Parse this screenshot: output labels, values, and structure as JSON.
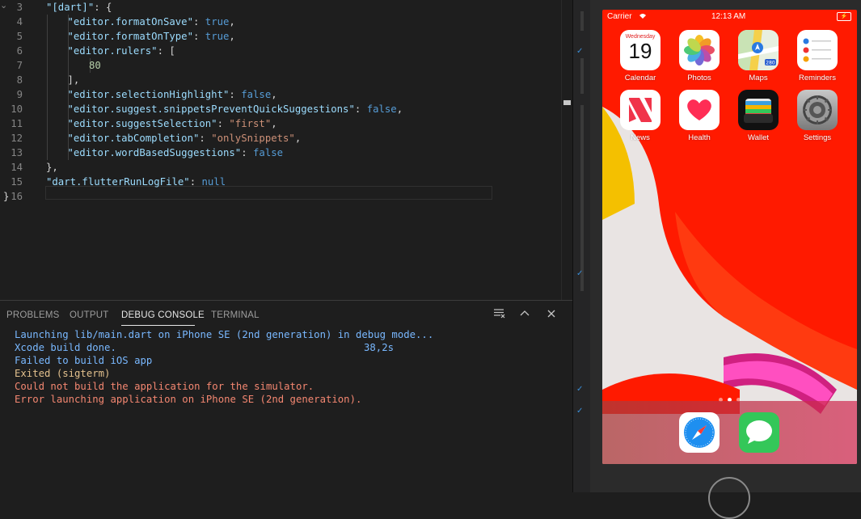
{
  "editor": {
    "lines": [
      {
        "n": "3",
        "parts": [
          [
            "k",
            "\"[dart]\""
          ],
          [
            "p",
            ": {"
          ]
        ]
      },
      {
        "n": "4",
        "parts": [
          [
            "k",
            "\"editor.formatOnSave\""
          ],
          [
            "p",
            ": "
          ],
          [
            "b",
            "true"
          ],
          [
            "p",
            ","
          ]
        ]
      },
      {
        "n": "5",
        "parts": [
          [
            "k",
            "\"editor.formatOnType\""
          ],
          [
            "p",
            ": "
          ],
          [
            "b",
            "true"
          ],
          [
            "p",
            ","
          ]
        ]
      },
      {
        "n": "6",
        "parts": [
          [
            "k",
            "\"editor.rulers\""
          ],
          [
            "p",
            ": ["
          ]
        ]
      },
      {
        "n": "7",
        "parts": [
          [
            "n",
            "80"
          ]
        ]
      },
      {
        "n": "8",
        "parts": [
          [
            "p",
            "],"
          ]
        ]
      },
      {
        "n": "9",
        "parts": [
          [
            "k",
            "\"editor.selectionHighlight\""
          ],
          [
            "p",
            ": "
          ],
          [
            "b",
            "false"
          ],
          [
            "p",
            ","
          ]
        ]
      },
      {
        "n": "10",
        "parts": [
          [
            "k",
            "\"editor.suggest.snippetsPreventQuickSuggestions\""
          ],
          [
            "p",
            ": "
          ],
          [
            "b",
            "false"
          ],
          [
            "p",
            ","
          ]
        ]
      },
      {
        "n": "11",
        "parts": [
          [
            "k",
            "\"editor.suggestSelection\""
          ],
          [
            "p",
            ": "
          ],
          [
            "s",
            "\"first\""
          ],
          [
            "p",
            ","
          ]
        ]
      },
      {
        "n": "12",
        "parts": [
          [
            "k",
            "\"editor.tabCompletion\""
          ],
          [
            "p",
            ": "
          ],
          [
            "s",
            "\"onlySnippets\""
          ],
          [
            "p",
            ","
          ]
        ]
      },
      {
        "n": "13",
        "parts": [
          [
            "k",
            "\"editor.wordBasedSuggestions\""
          ],
          [
            "p",
            ": "
          ],
          [
            "b",
            "false"
          ]
        ]
      },
      {
        "n": "14",
        "parts": [
          [
            "p",
            "},"
          ]
        ]
      },
      {
        "n": "15",
        "parts": [
          [
            "k",
            "\"dart.flutterRunLogFile\""
          ],
          [
            "p",
            ": "
          ],
          [
            "b",
            "null"
          ]
        ]
      },
      {
        "n": "16",
        "parts": [
          [
            "p",
            "}"
          ]
        ]
      }
    ]
  },
  "panel": {
    "tabs": [
      "PROBLEMS",
      "OUTPUT",
      "DEBUG CONSOLE",
      "TERMINAL"
    ],
    "active_tab": "DEBUG CONSOLE",
    "icons": [
      "clear-console-icon",
      "maximize-panel-icon",
      "close-panel-icon"
    ],
    "console": [
      {
        "text": "Launching lib/main.dart on iPhone SE (2nd generation) in debug mode...",
        "kind": "blue"
      },
      {
        "text": "Xcode build done.",
        "suffix": "38,2s",
        "kind": "blue"
      },
      {
        "text": "Failed to build iOS app",
        "kind": "blue"
      },
      {
        "text": "Exited (sigterm)",
        "kind": "yellow"
      },
      {
        "text": "Could not build the application for the simulator.",
        "kind": "red"
      },
      {
        "text": "Error launching application on iPhone SE (2nd generation).",
        "kind": "red"
      }
    ]
  },
  "phone": {
    "status": {
      "carrier": "Carrier",
      "time": "12:13 AM"
    },
    "apps": [
      {
        "label": "Calendar",
        "icon": "calendar-icon",
        "day": "Wednesday",
        "date": "19"
      },
      {
        "label": "Photos",
        "icon": "photos-icon"
      },
      {
        "label": "Maps",
        "icon": "maps-icon",
        "badge": "280"
      },
      {
        "label": "Reminders",
        "icon": "reminders-icon"
      },
      {
        "label": "News",
        "icon": "news-icon"
      },
      {
        "label": "Health",
        "icon": "health-icon"
      },
      {
        "label": "Wallet",
        "icon": "wallet-icon"
      },
      {
        "label": "Settings",
        "icon": "settings-icon"
      }
    ],
    "dock": [
      "safari-icon",
      "messages-icon"
    ],
    "page_dots": 3,
    "active_page": 1
  }
}
